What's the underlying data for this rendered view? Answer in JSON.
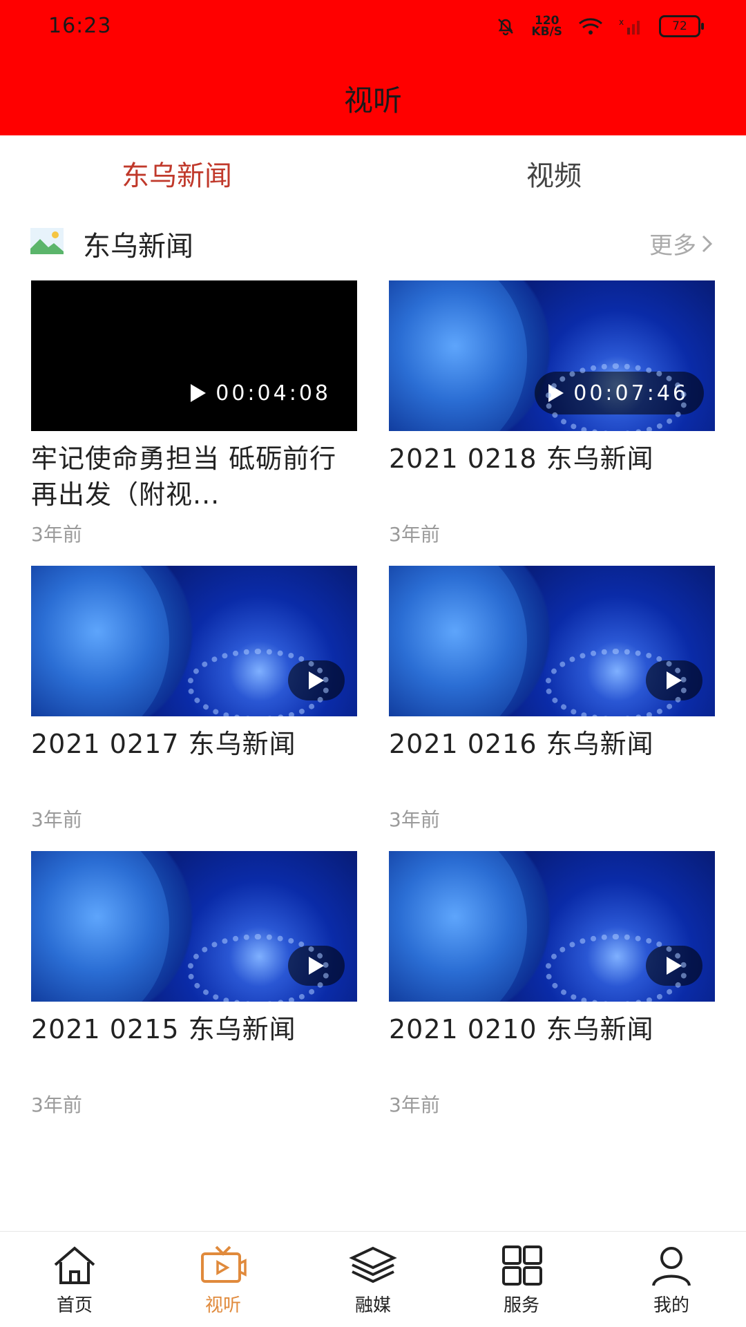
{
  "status_bar": {
    "time": "16:23",
    "speed": "120\nKB/S",
    "speed_top": "120",
    "speed_bottom": "KB/S",
    "battery": "72"
  },
  "header": {
    "title": "视听"
  },
  "tabs": [
    {
      "label": "东乌新闻",
      "active": true
    },
    {
      "label": "视频",
      "active": false
    }
  ],
  "section": {
    "title": "东乌新闻",
    "more_label": "更多"
  },
  "videos": [
    {
      "title": "牢记使命勇担当  砥砺前行再出发（附视...",
      "time": "3年前",
      "duration": "00:04:08"
    },
    {
      "title": "2021  0218  东乌新闻",
      "time": "3年前",
      "duration": "00:07:46"
    },
    {
      "title": "2021  0217  东乌新闻",
      "time": "3年前"
    },
    {
      "title": "2021  0216  东乌新闻",
      "time": "3年前"
    },
    {
      "title": "2021  0215  东乌新闻",
      "time": "3年前"
    },
    {
      "title": "2021  0210  东乌新闻",
      "time": "3年前"
    }
  ],
  "bottom_nav": [
    {
      "label": "首页",
      "icon": "home-icon"
    },
    {
      "label": "视听",
      "icon": "tv-icon",
      "active": true
    },
    {
      "label": "融媒",
      "icon": "layers-icon"
    },
    {
      "label": "服务",
      "icon": "grid-icon"
    },
    {
      "label": "我的",
      "icon": "user-icon"
    }
  ],
  "colors": {
    "header_bg": "#ff0000",
    "tab_active": "#c0392b",
    "nav_active": "#e08a3c"
  }
}
